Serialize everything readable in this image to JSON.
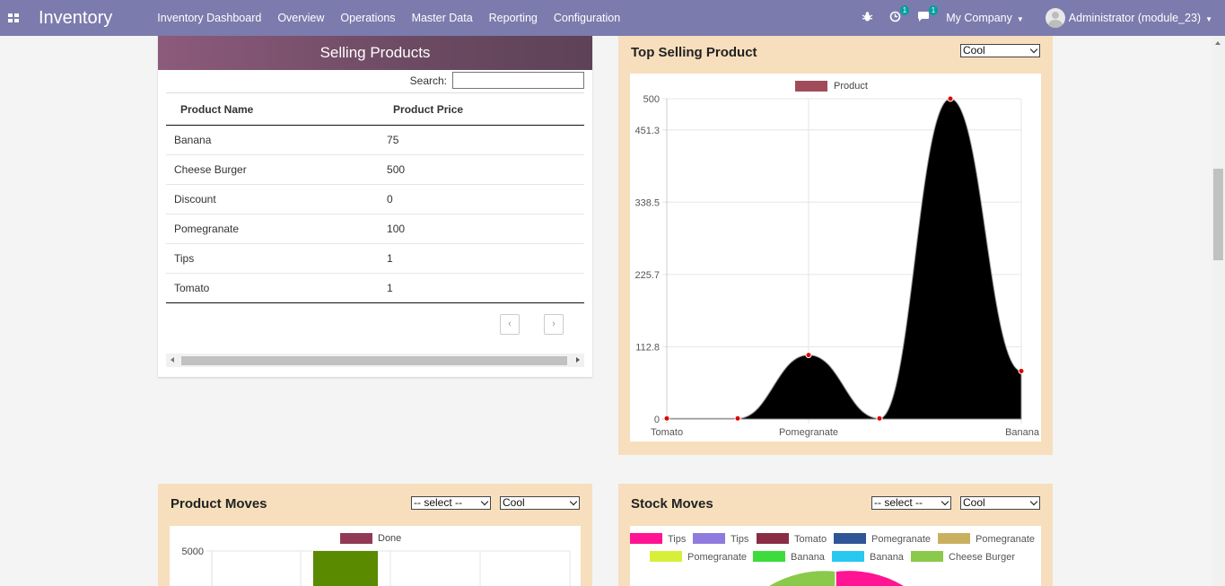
{
  "nav": {
    "app_title": "Inventory",
    "menu": [
      "Inventory Dashboard",
      "Overview",
      "Operations",
      "Master Data",
      "Reporting",
      "Configuration"
    ],
    "activity_badge": "1",
    "messages_badge": "1",
    "company": "My Company",
    "user": "Administrator (module_23)",
    "icons": [
      "apps-icon",
      "bug-icon",
      "clock-icon",
      "chat-icon"
    ]
  },
  "selling_products": {
    "title": "Selling Products",
    "search_label": "Search:",
    "search_value": "",
    "columns": [
      "Product Name",
      "Product Price"
    ],
    "rows": [
      [
        "Banana",
        "75"
      ],
      [
        "Cheese Burger",
        "500"
      ],
      [
        "Discount",
        "0"
      ],
      [
        "Pomegranate",
        "100"
      ],
      [
        "Tips",
        "1"
      ],
      [
        "Tomato",
        "1"
      ]
    ],
    "prev": "‹",
    "next": "›"
  },
  "top_selling": {
    "title": "Top Selling Product",
    "select_value": "Cool"
  },
  "product_moves": {
    "title": "Product Moves",
    "select1_value": "-- select --",
    "select2_value": "Cool"
  },
  "stock_moves": {
    "title": "Stock Moves",
    "select1_value": "-- select --",
    "select2_value": "Cool"
  },
  "chart_data": [
    {
      "type": "line",
      "legend": [
        "Product"
      ],
      "legend_color": "#a04b5a",
      "fill_color": "#000000",
      "point_color": "#e00000",
      "x_ticks": [
        "Tomato",
        "Pomegranate",
        "Banana"
      ],
      "y_ticks": [
        "0",
        "112.8",
        "225.7",
        "338.5",
        "451.3",
        "500"
      ],
      "ylim": [
        0,
        500
      ],
      "points": [
        1,
        1,
        100,
        1,
        500,
        75
      ],
      "grid": true
    },
    {
      "type": "bar",
      "legend": [
        "Done"
      ],
      "legend_color": "#923a55",
      "bar_color": "#5a8a00",
      "y_ticks": [
        "5000"
      ],
      "values": [
        5000
      ],
      "grid": true
    },
    {
      "type": "pie",
      "legend": [
        "Tips",
        "Tips",
        "Tomato",
        "Pomegranate",
        "Pomegranate",
        "Pomegranate",
        "Banana",
        "Banana",
        "Cheese Burger"
      ],
      "colors": [
        "#ff1493",
        "#8f7bde",
        "#8b2c45",
        "#2f5596",
        "#c9b060",
        "#d8ef3a",
        "#3ddc3d",
        "#29c8f0",
        "#8ac94a"
      ]
    }
  ]
}
